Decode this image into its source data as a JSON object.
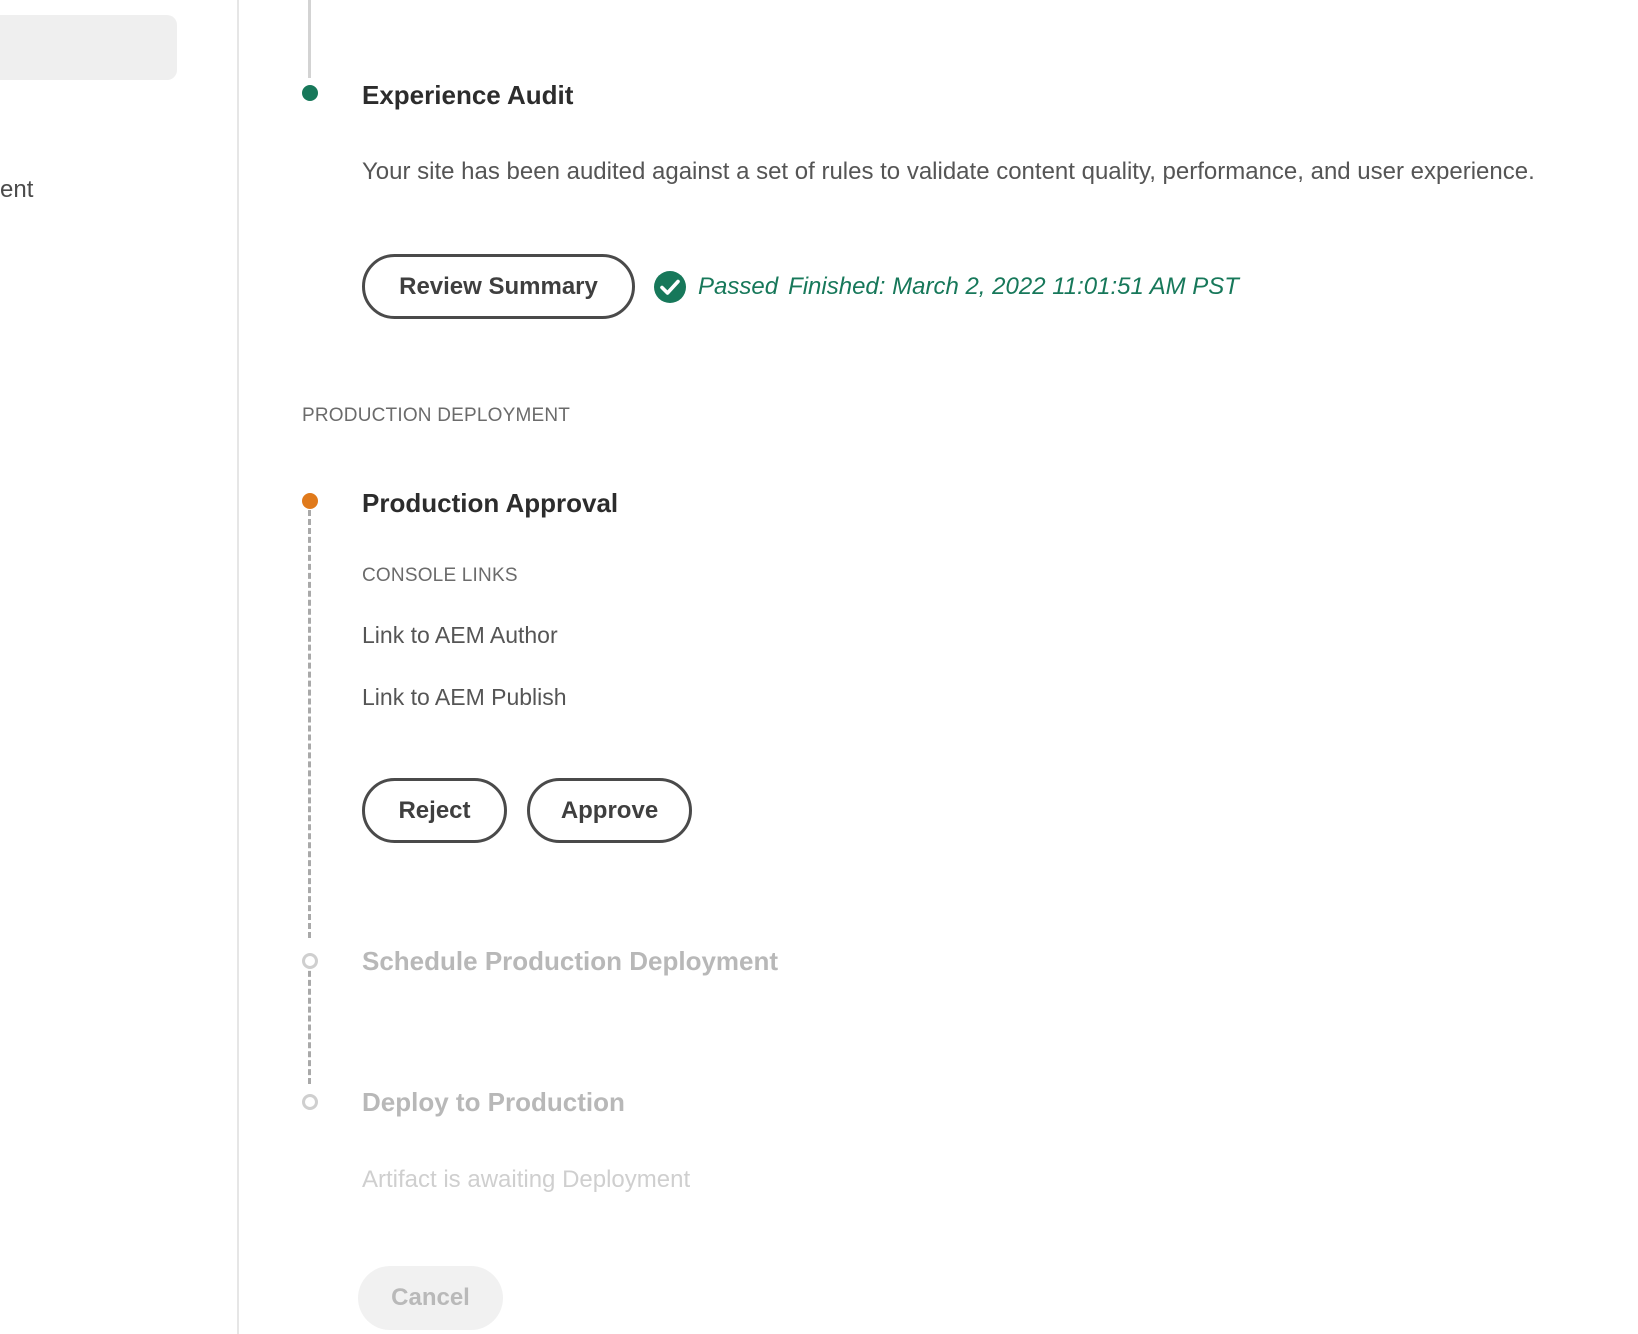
{
  "sidebar": {
    "partial_label": "ent"
  },
  "experience_audit": {
    "title": "Experience Audit",
    "description": "Your site has been audited against a set of rules to validate content quality, performance, and user experience.",
    "review_button_label": "Review Summary",
    "status_text": "Passed",
    "finished_text": "Finished: March 2, 2022 11:01:51 AM PST",
    "status_icon": "check-circle-icon",
    "status_color": "#17785a"
  },
  "production_deployment": {
    "section_heading": "PRODUCTION DEPLOYMENT",
    "approval": {
      "title": "Production Approval",
      "console_links_heading": "CONSOLE LINKS",
      "links": [
        "Link to AEM Author",
        "Link to AEM Publish"
      ],
      "reject_label": "Reject",
      "approve_label": "Approve",
      "status_color": "#e07a1b"
    },
    "schedule": {
      "title": "Schedule Production Deployment"
    },
    "deploy": {
      "title": "Deploy to Production",
      "description": "Artifact is awaiting Deployment",
      "cancel_label": "Cancel"
    }
  }
}
